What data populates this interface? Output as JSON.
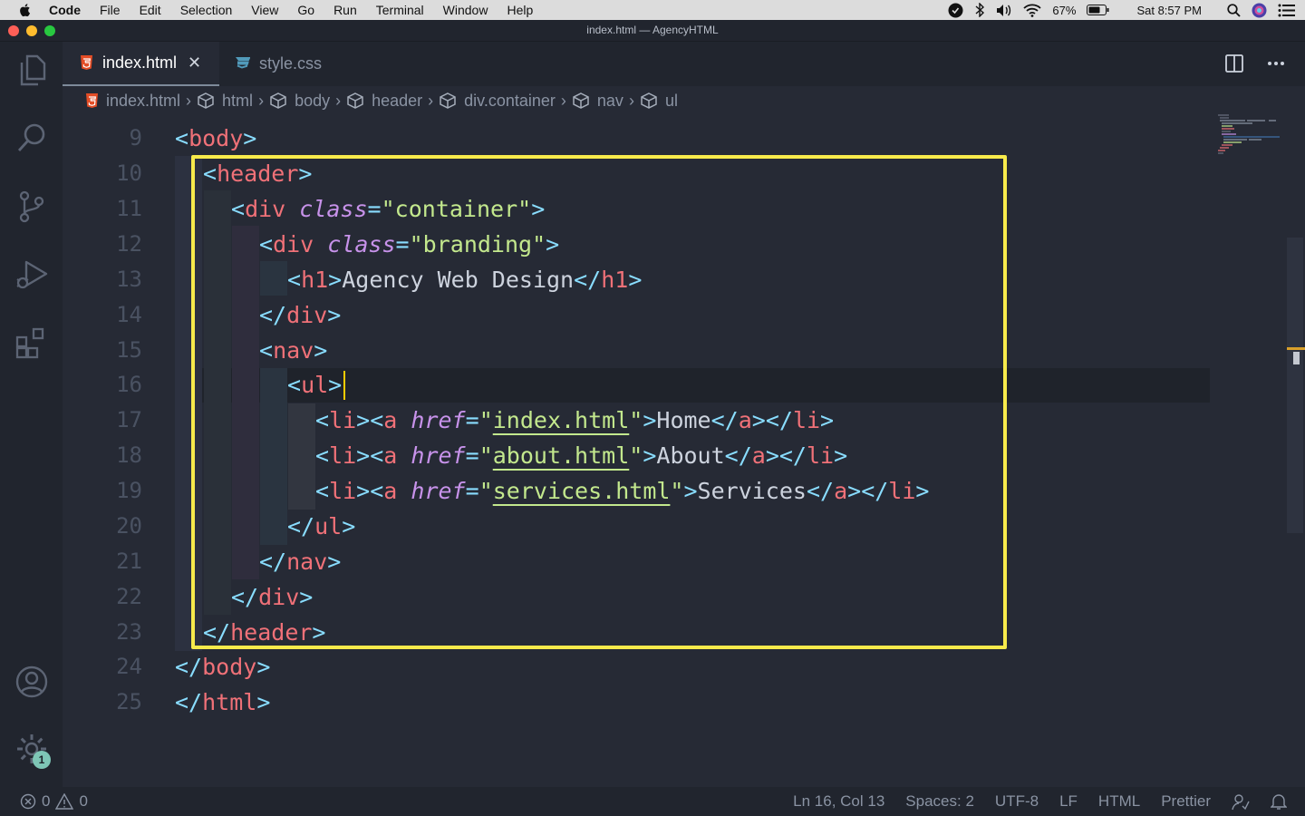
{
  "menubar": {
    "items": [
      "Code",
      "File",
      "Edit",
      "Selection",
      "View",
      "Go",
      "Run",
      "Terminal",
      "Window",
      "Help"
    ],
    "battery": "67%",
    "clock": "Sat 8:57 PM"
  },
  "window": {
    "title": "index.html — AgencyHTML"
  },
  "tabs": [
    {
      "label": "index.html",
      "icon": "html5-icon",
      "active": true
    },
    {
      "label": "style.css",
      "icon": "css3-icon",
      "active": false
    }
  ],
  "breadcrumb": [
    "index.html",
    "html",
    "body",
    "header",
    "div.container",
    "nav",
    "ul"
  ],
  "editor": {
    "line_numbers": [
      "9",
      "10",
      "11",
      "12",
      "13",
      "14",
      "15",
      "16",
      "17",
      "18",
      "19",
      "20",
      "21",
      "22",
      "23",
      "24",
      "25"
    ],
    "lines": {
      "l9": {
        "tag": "body"
      },
      "l10": {
        "tag": "header"
      },
      "l11": {
        "tag": "div",
        "attr": "class",
        "value": "container"
      },
      "l12": {
        "tag": "div",
        "attr": "class",
        "value": "branding"
      },
      "l13": {
        "tag": "h1",
        "text": "Agency Web Design"
      },
      "l14": {
        "tag": "div"
      },
      "l15": {
        "tag": "nav"
      },
      "l16": {
        "tag": "ul"
      },
      "l17": {
        "li": "li",
        "a": "a",
        "attr": "href",
        "value": "index.html",
        "text": "Home"
      },
      "l18": {
        "li": "li",
        "a": "a",
        "attr": "href",
        "value": "about.html",
        "text": "About"
      },
      "l19": {
        "li": "li",
        "a": "a",
        "attr": "href",
        "value": "services.html",
        "text": "Services"
      },
      "l20": {
        "tag": "ul"
      },
      "l21": {
        "tag": "nav"
      },
      "l22": {
        "tag": "div"
      },
      "l23": {
        "tag": "header"
      },
      "l24": {
        "tag": "body"
      },
      "l25": {
        "tag": "html"
      }
    },
    "current_line": "16",
    "highlight_color": "#f7ea4b"
  },
  "statusbar": {
    "errors": "0",
    "warnings": "0",
    "position": "Ln 16, Col 13",
    "spaces": "Spaces: 2",
    "encoding": "UTF-8",
    "eol": "LF",
    "language": "HTML",
    "formatter": "Prettier"
  },
  "activity": {
    "settings_badge": "1"
  },
  "colors": {
    "tag": "#f07178",
    "bracket": "#89ddff",
    "attr": "#c792ea",
    "string": "#c3e88d",
    "background": "#262a35"
  }
}
